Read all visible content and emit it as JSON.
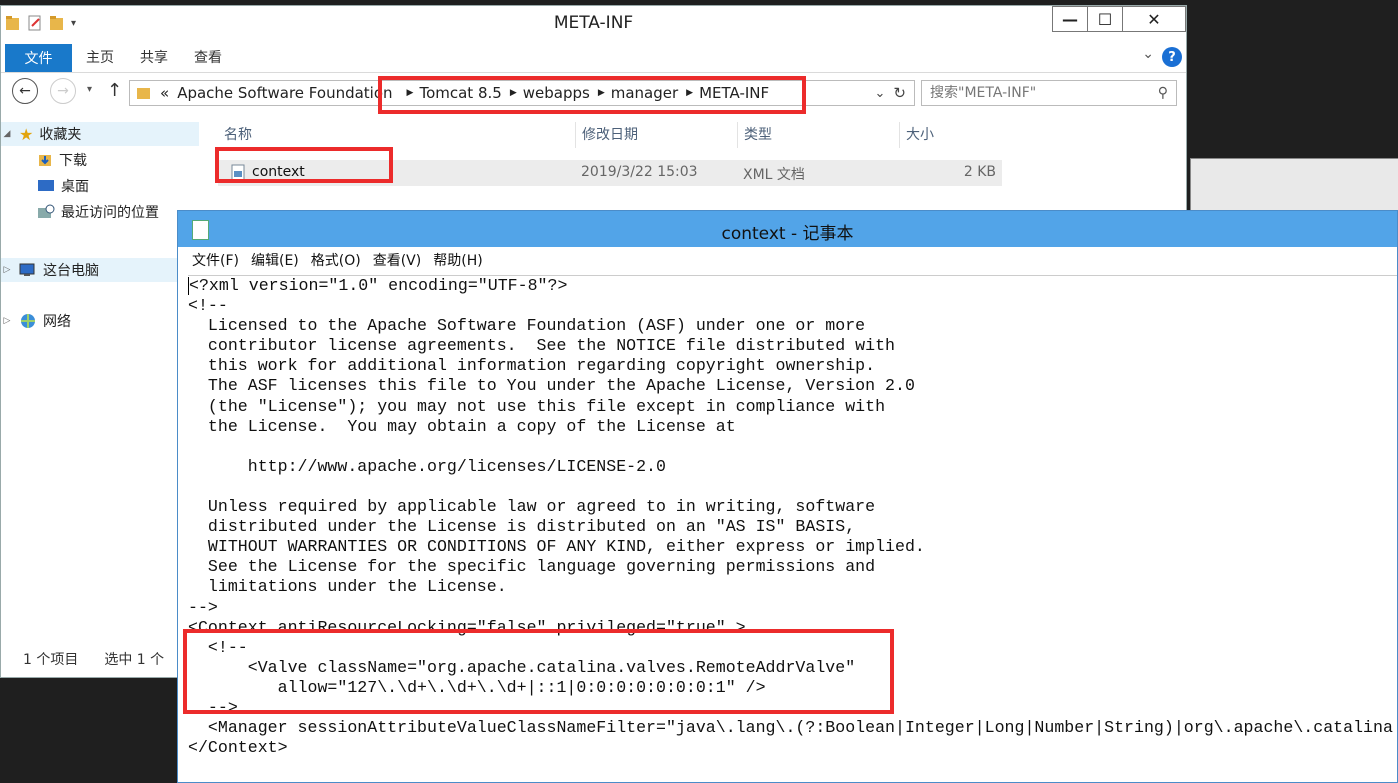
{
  "explorer": {
    "title": "META-INF",
    "window_buttons": {
      "minimize": "—",
      "maximize": "☐",
      "close": "✕"
    },
    "ribbon_tabs": [
      "文件",
      "主页",
      "共享",
      "查看"
    ],
    "help": "?",
    "address_prefix": "«",
    "breadcrumb": [
      "Apache Software Foundation",
      "Tomcat 8.5",
      "webapps",
      "manager",
      "META-INF"
    ],
    "search_placeholder": "搜索\"META-INF\"",
    "nav": [
      {
        "label": "收藏夹",
        "icon": "star-icon"
      },
      {
        "label": "下载",
        "icon": "folder-download-icon"
      },
      {
        "label": "桌面",
        "icon": "desktop-icon"
      },
      {
        "label": "最近访问的位置",
        "icon": "recent-icon"
      },
      {
        "label": "这台电脑",
        "icon": "computer-icon"
      },
      {
        "label": "网络",
        "icon": "network-icon"
      }
    ],
    "columns": [
      "名称",
      "修改日期",
      "类型",
      "大小"
    ],
    "files": [
      {
        "name": "context",
        "modified": "2019/3/22 15:03",
        "type": "XML 文档",
        "size": "2 KB"
      }
    ],
    "status": {
      "items": "1 个项目",
      "selected": "选中 1 个"
    }
  },
  "notepad": {
    "title": "context - 记事本",
    "menu": [
      "文件(F)",
      "编辑(E)",
      "格式(O)",
      "查看(V)",
      "帮助(H)"
    ],
    "lines": [
      "<?xml version=\"1.0\" encoding=\"UTF-8\"?>",
      "<!--",
      "  Licensed to the Apache Software Foundation (ASF) under one or more",
      "  contributor license agreements.  See the NOTICE file distributed with",
      "  this work for additional information regarding copyright ownership.",
      "  The ASF licenses this file to You under the Apache License, Version 2.0",
      "  (the \"License\"); you may not use this file except in compliance with",
      "  the License.  You may obtain a copy of the License at",
      "",
      "      http://www.apache.org/licenses/LICENSE-2.0",
      "",
      "  Unless required by applicable law or agreed to in writing, software",
      "  distributed under the License is distributed on an \"AS IS\" BASIS,",
      "  WITHOUT WARRANTIES OR CONDITIONS OF ANY KIND, either express or implied.",
      "  See the License for the specific language governing permissions and",
      "  limitations under the License.",
      "-->",
      "<Context antiResourceLocking=\"false\" privileged=\"true\" >",
      "  <!--",
      "      <Valve className=\"org.apache.catalina.valves.RemoteAddrValve\"",
      "         allow=\"127\\.\\d+\\.\\d+\\.\\d+|::1|0:0:0:0:0:0:0:1\" />",
      "  -->",
      "  <Manager sessionAttributeValueClassNameFilter=\"java\\.lang\\.(?:Boolean|Integer|Long|Number|String)|org\\.apache\\.catalina",
      "</Context>"
    ]
  },
  "colors": {
    "accent": "#1979ca",
    "notepad_title": "#52a4e8",
    "highlight": "#ec2b2b"
  }
}
